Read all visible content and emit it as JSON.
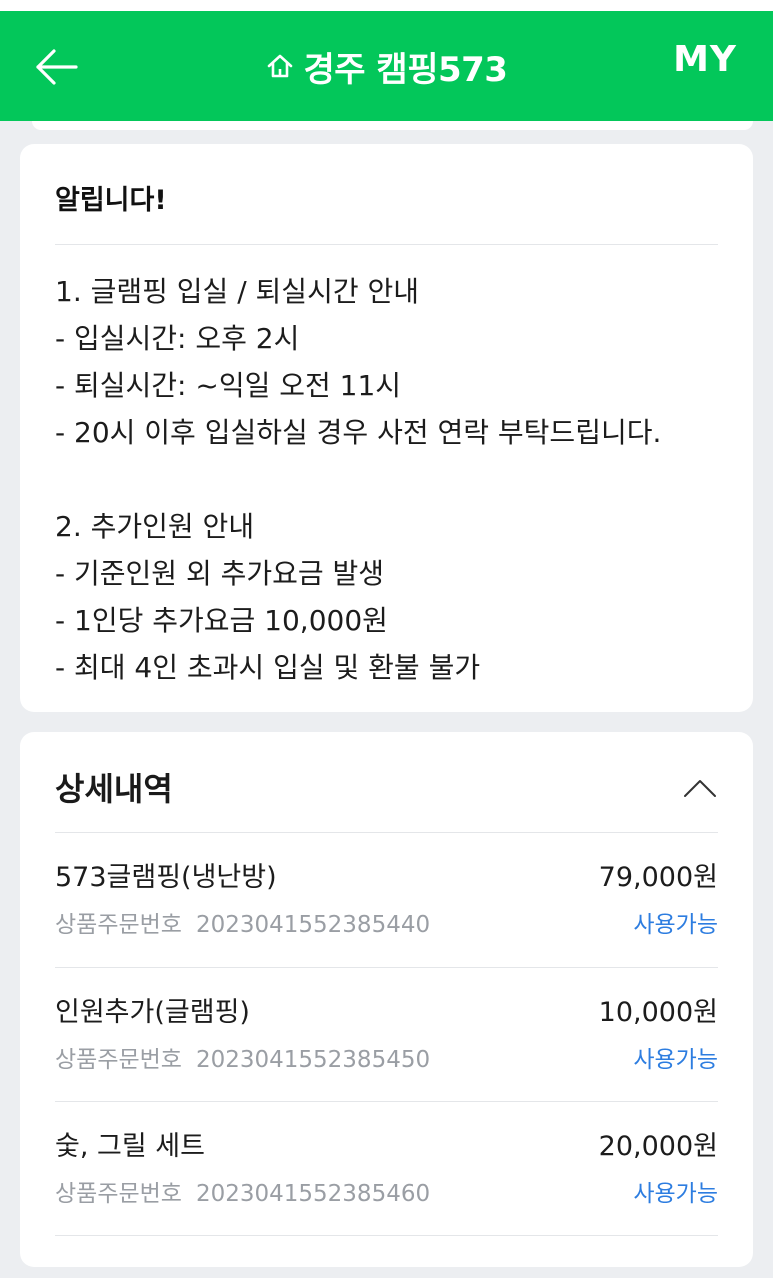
{
  "header": {
    "title": "경주 캠핑573",
    "my_label": "MY",
    "icons": {
      "back": "arrow-left-icon",
      "home": "home-icon"
    },
    "bg_color": "#03c75a"
  },
  "notice": {
    "title": "알립니다!",
    "lines": [
      "1. 글램핑 입실 / 퇴실시간 안내",
      "- 입실시간: 오후 2시",
      "- 퇴실시간: ~익일 오전 11시",
      "- 20시 이후 입실하실 경우 사전 연락 부탁드립니다.",
      "",
      "2. 추가인원 안내",
      "- 기준인원 외 추가요금 발생",
      "- 1인당 추가요금 10,000원",
      "- 최대 4인 초과시 입실 및 환불 불가"
    ]
  },
  "detail": {
    "title": "상세내역",
    "toggle_icon": "chevron-up-icon",
    "items": [
      {
        "name": "573글램핑(냉난방)",
        "price": "79,000원",
        "order_label": "상품주문번호",
        "order_number": "2023041552385440",
        "status": "사용가능"
      },
      {
        "name": "인원추가(글램핑)",
        "price": "10,000원",
        "order_label": "상품주문번호",
        "order_number": "2023041552385450",
        "status": "사용가능"
      },
      {
        "name": "숯, 그릴 세트",
        "price": "20,000원",
        "order_label": "상품주문번호",
        "order_number": "2023041552385460",
        "status": "사용가능"
      }
    ],
    "status_color": "#2d7de0"
  }
}
